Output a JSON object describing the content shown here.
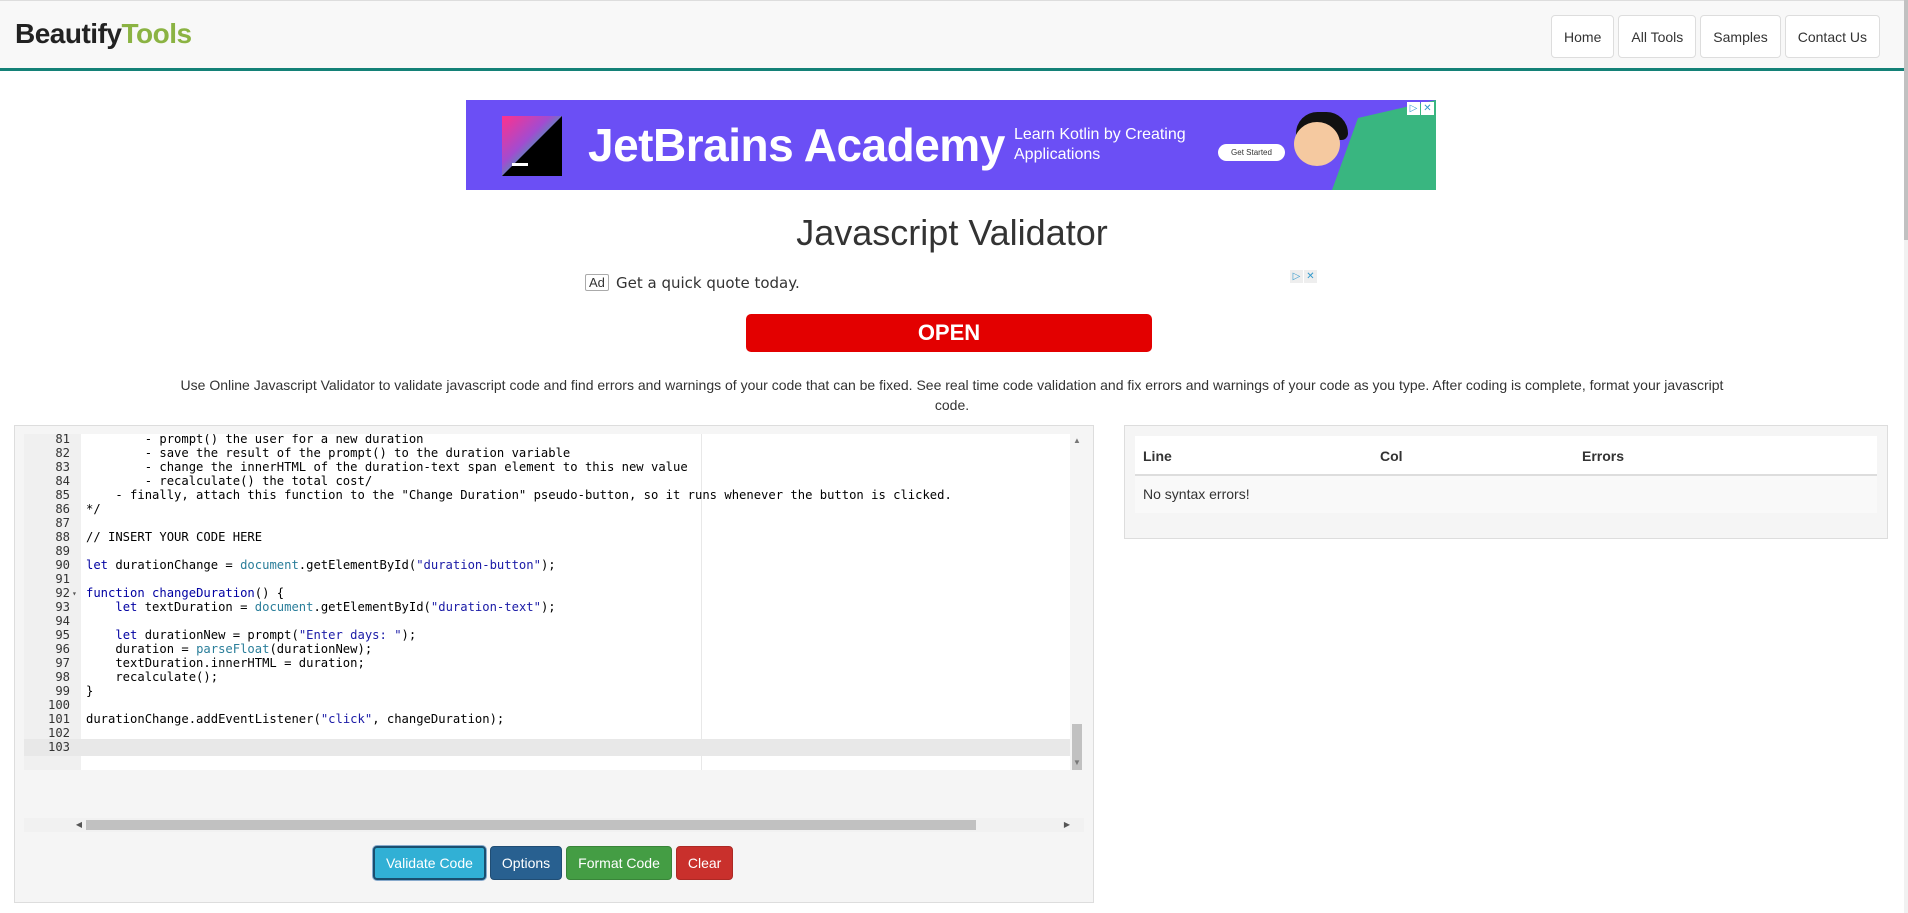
{
  "brand": {
    "part1": "Beautify",
    "part2": "Tools"
  },
  "nav": [
    "Home",
    "All Tools",
    "Samples",
    "Contact Us"
  ],
  "banner_ad": {
    "title": "JetBrains Academy",
    "subtitle": "Learn Kotlin by Creating Applications",
    "cta": "Get Started"
  },
  "page_title": "Javascript Validator",
  "text_ad": {
    "label": "Ad",
    "text": "Get a quick quote today.",
    "cta": "OPEN"
  },
  "description": "Use Online Javascript Validator to validate javascript code and find errors and warnings of your code that can be fixed. See real time code validation and fix errors and warnings of your code as you type. After coding is complete, format your javascript code.",
  "editor": {
    "lines": [
      {
        "n": "81",
        "t": "        - prompt() the user for a new duration",
        "c": "comment"
      },
      {
        "n": "82",
        "t": "        - save the result of the prompt() to the duration variable",
        "c": "comment"
      },
      {
        "n": "83",
        "t": "        - change the innerHTML of the duration-text span element to this new value",
        "c": "comment"
      },
      {
        "n": "84",
        "t": "        - recalculate() the total cost/",
        "c": "comment"
      },
      {
        "n": "85",
        "t": "    - finally, attach this function to the \"Change Duration\" pseudo-button, so it runs whenever the button is clicked.",
        "c": "comment"
      },
      {
        "n": "86",
        "t": "*/",
        "c": "comment"
      },
      {
        "n": "87",
        "t": "",
        "c": ""
      },
      {
        "n": "88",
        "t": "// INSERT YOUR CODE HERE",
        "c": "comment"
      },
      {
        "n": "89",
        "t": "",
        "c": ""
      },
      {
        "n": "90",
        "t": "let durationChange = document.getElementById(\"duration-button\");",
        "c": ""
      },
      {
        "n": "91",
        "t": "",
        "c": ""
      },
      {
        "n": "92",
        "t": "function changeDuration() {",
        "c": ""
      },
      {
        "n": "93",
        "t": "    let textDuration = document.getElementById(\"duration-text\");",
        "c": ""
      },
      {
        "n": "94",
        "t": "",
        "c": ""
      },
      {
        "n": "95",
        "t": "    let durationNew = prompt(\"Enter days: \");",
        "c": ""
      },
      {
        "n": "96",
        "t": "    duration = parseFloat(durationNew);",
        "c": ""
      },
      {
        "n": "97",
        "t": "    textDuration.innerHTML = duration;",
        "c": ""
      },
      {
        "n": "98",
        "t": "    recalculate();",
        "c": ""
      },
      {
        "n": "99",
        "t": "}",
        "c": ""
      },
      {
        "n": "100",
        "t": "",
        "c": ""
      },
      {
        "n": "101",
        "t": "durationChange.addEventListener(\"click\", changeDuration);",
        "c": ""
      },
      {
        "n": "102",
        "t": "",
        "c": ""
      },
      {
        "n": "103",
        "t": "",
        "c": "active"
      }
    ]
  },
  "buttons": {
    "validate": "Validate Code",
    "options": "Options",
    "format": "Format Code",
    "clear": "Clear"
  },
  "errors_table": {
    "headers": [
      "Line",
      "Col",
      "Errors"
    ],
    "message": "No syntax errors!"
  },
  "colors": {
    "accent": "#148177",
    "brand_green": "#8bb343",
    "ad_purple": "#6b4ff5",
    "open_red": "#e30000"
  }
}
